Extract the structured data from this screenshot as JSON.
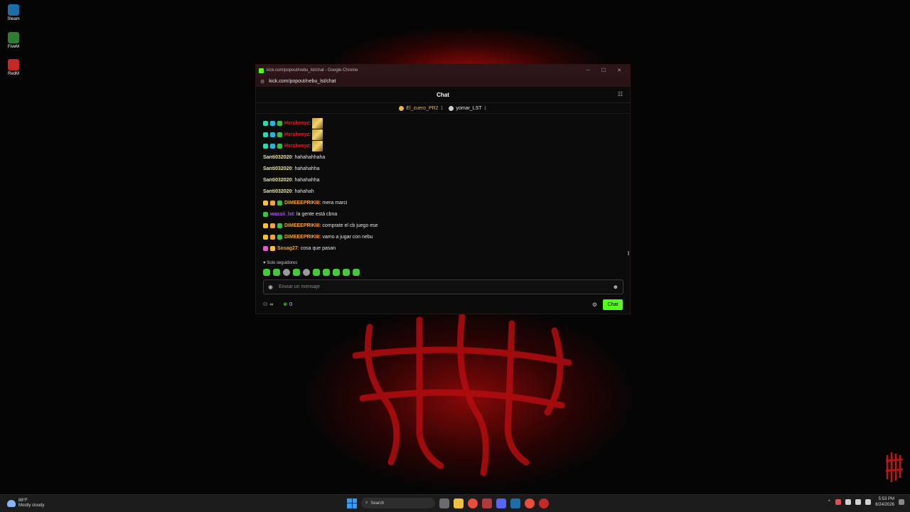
{
  "desktop": {
    "icons": [
      {
        "label": "Steam",
        "icon": "steam-icon",
        "color": "#1b6ea8"
      },
      {
        "label": "FiveM",
        "icon": "fivem-icon",
        "color": "#2e7d32"
      },
      {
        "label": "RedM",
        "icon": "redm-icon",
        "color": "#c62828"
      }
    ]
  },
  "window": {
    "title": "kick.com/popout/nebu_lst/chat - Google Chrome",
    "url": "kick.com/popout/nebu_lst/chat",
    "controls": [
      "─",
      "☐",
      "✕"
    ]
  },
  "chat": {
    "header_title": "Chat",
    "pinned": [
      {
        "name": "El_zuero_PR2",
        "count": "1",
        "color": "#f2b63c",
        "dot": "#f2b63c"
      },
      {
        "name": "yomar_LST",
        "count": "1",
        "color": "#e8e8e8",
        "dot": "#cfcfcf"
      }
    ],
    "messages": [
      {
        "badges": [
          "#37d6a8",
          "#27b5e5",
          "#3cbf4a"
        ],
        "user": "Hxrsheeyz",
        "user_color": "#e0232d",
        "text": "",
        "emote": true
      },
      {
        "badges": [
          "#37d6a8",
          "#27b5e5",
          "#3cbf4a"
        ],
        "user": "Hxrsheeyz",
        "user_color": "#e0232d",
        "text": "",
        "emote": true
      },
      {
        "badges": [
          "#37d6a8",
          "#27b5e5",
          "#3cbf4a"
        ],
        "user": "Hxrsheeyz",
        "user_color": "#e0232d",
        "text": "",
        "emote": true
      },
      {
        "badges": [],
        "user": "Santi032020",
        "user_color": "#e8e6a2",
        "text": "hahahahhaha",
        "emote": false
      },
      {
        "badges": [],
        "user": "Santi032020",
        "user_color": "#e8e6a2",
        "text": "hahahahha",
        "emote": false
      },
      {
        "badges": [],
        "user": "Santi032020",
        "user_color": "#e8e6a2",
        "text": "hahahahha",
        "emote": false
      },
      {
        "badges": [],
        "user": "Santi032020",
        "user_color": "#e8e6a2",
        "text": "hahahah",
        "emote": false
      },
      {
        "badges": [
          "#f2c23c",
          "#f2a23c",
          "#3cbf4a"
        ],
        "user": "DIMEEEPRIKIII",
        "user_color": "#f0a53a",
        "text": "mera marci",
        "emote": false
      },
      {
        "badges": [
          "#3cbf4a"
        ],
        "user": "wassii_lst",
        "user_color": "#b05cf0",
        "text": "la gente está cbna",
        "emote": false
      },
      {
        "badges": [
          "#f2c23c",
          "#f2a23c",
          "#3cbf4a"
        ],
        "user": "DIMEEEPRIKIII",
        "user_color": "#f0a53a",
        "text": "comprate el cb juego ese",
        "emote": false
      },
      {
        "badges": [
          "#f2c23c",
          "#f2a23c",
          "#3cbf4a"
        ],
        "user": "DIMEEEPRIKIII",
        "user_color": "#f0a53a",
        "text": "vamo a jugar con nebu",
        "emote": false
      },
      {
        "badges": [
          "#e05cc8",
          "#f2c23c"
        ],
        "user": "Sosag27",
        "user_color": "#f0a53a",
        "text": "cosa que pasan",
        "emote": false
      }
    ],
    "mode_label": "Solo seguidores",
    "emotes": [
      "kick-emote",
      "kick-emote",
      "gray-emote",
      "kick-emote",
      "gray-emote",
      "kick-emote",
      "kick-emote",
      "kick-emote",
      "kick-emote",
      "kick-emote"
    ],
    "input_placeholder": "Enviar un mensaje",
    "footer": {
      "infinity": "∞",
      "points": "0",
      "send_label": "Chat"
    },
    "accent": "#53fc18"
  },
  "taskbar": {
    "weather_temp": "88°F",
    "weather_desc": "Mostly cloudy",
    "search_label": "Search",
    "time": "5:53 PM",
    "date": "6/24/2026"
  }
}
